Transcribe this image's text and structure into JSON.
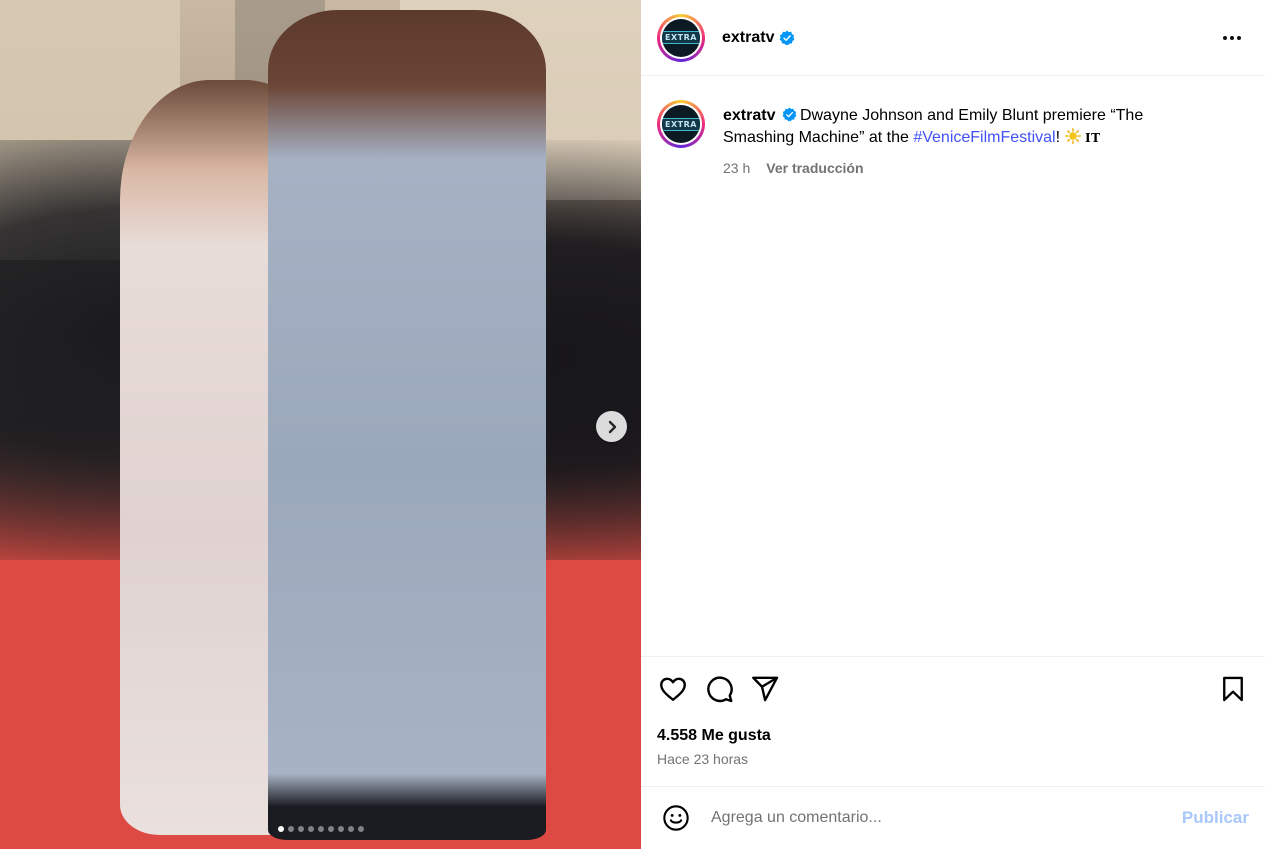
{
  "post": {
    "author": "extratv",
    "avatar_logo_text": "EXTRA",
    "caption": {
      "username": "extratv",
      "text_before": "Dwayne Johnson and Emily Blunt premiere “The Smashing Machine” at the ",
      "hashtag": "#VeniceFilmFestival",
      "text_after": "! ",
      "emoji": "sun",
      "suffix": "IT"
    },
    "caption_time": "23 h",
    "translate_label": "Ver traducción",
    "likes": "4.558 Me gusta",
    "posted_ago": "Hace 23 horas"
  },
  "media": {
    "slide_count": 9,
    "current_slide": 1
  },
  "comment_form": {
    "placeholder": "Agrega un comentario...",
    "publish_label": "Publicar"
  },
  "colors": {
    "verified": "#0095f6",
    "hashtag": "#4150f7",
    "publish_disabled": "#a8c7fa",
    "muted_text": "#737373"
  },
  "icons": [
    "verified-badge-icon",
    "more-options-icon",
    "heart-icon",
    "comment-icon",
    "share-icon",
    "bookmark-icon",
    "emoji-icon",
    "chevron-right-icon"
  ]
}
